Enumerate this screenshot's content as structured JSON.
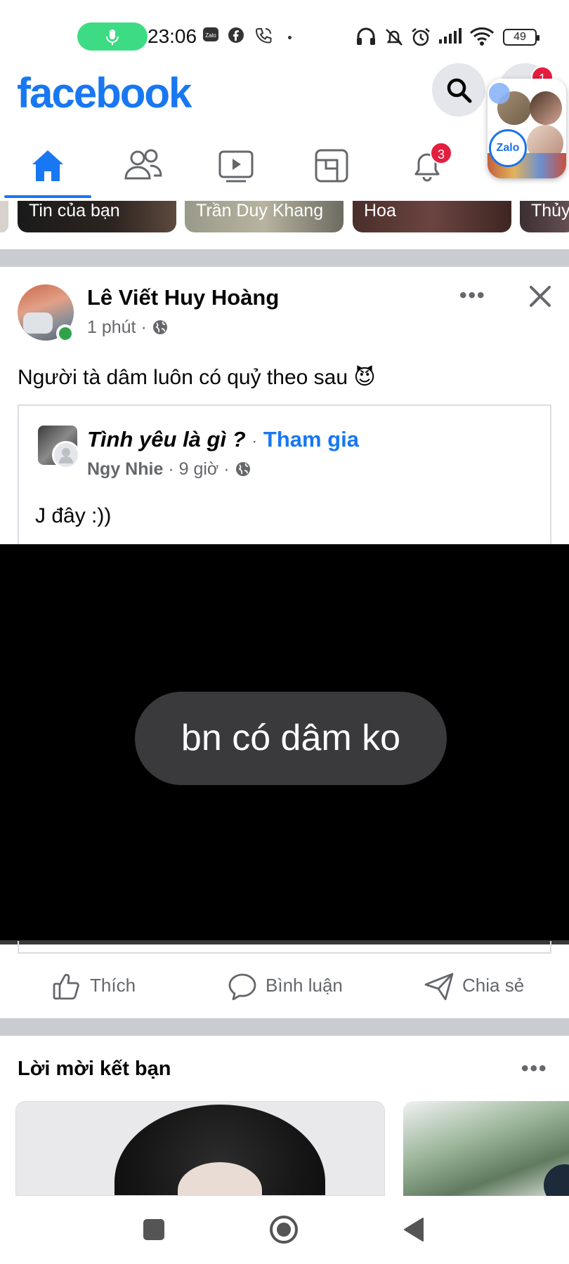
{
  "status_bar": {
    "time": "23:06",
    "battery": "49",
    "icons": [
      "mic-icon",
      "zalo-icon",
      "facebook-icon",
      "phone-icon",
      "dot-icon",
      "headphones-icon",
      "bell-muted-icon",
      "alarm-icon",
      "signal-icon",
      "wifi-icon",
      "battery-icon"
    ]
  },
  "header": {
    "logo": "facebook",
    "messenger_badge": "1"
  },
  "tabs": [
    {
      "name": "home",
      "icon": "home-icon",
      "active": true
    },
    {
      "name": "friends",
      "icon": "friends-icon"
    },
    {
      "name": "watch",
      "icon": "video-icon"
    },
    {
      "name": "feeds",
      "icon": "feeds-icon"
    },
    {
      "name": "notifications",
      "icon": "bell-icon",
      "badge": "3"
    }
  ],
  "stories": [
    {
      "label": "Tin của bạn"
    },
    {
      "label": "Trần Duy Khang"
    },
    {
      "label": "Hoa"
    },
    {
      "label": "Thủy"
    }
  ],
  "post": {
    "author": "Lê Viết Huy Hoàng",
    "time": "1 phút",
    "text": "Người tà dâm luôn có quỷ theo sau",
    "emoji": "😈",
    "shared": {
      "group_name": "Tình yêu là gì ?",
      "separator": "·",
      "join_label": "Tham gia",
      "poster": "Ngy Nhie",
      "time": "9 giờ",
      "text": "J đây :))",
      "media_text": "bn có dâm ko"
    },
    "actions": {
      "like": "Thích",
      "comment": "Bình luận",
      "share": "Chia sẻ"
    }
  },
  "friend_requests": {
    "title": "Lời mời kết bạn"
  },
  "overlay": {
    "app_label": "Zalo"
  },
  "colors": {
    "brand": "#1877f2",
    "badge": "#e41e3f",
    "divider": "#c9ccd1",
    "secondary_text": "#65676b"
  }
}
